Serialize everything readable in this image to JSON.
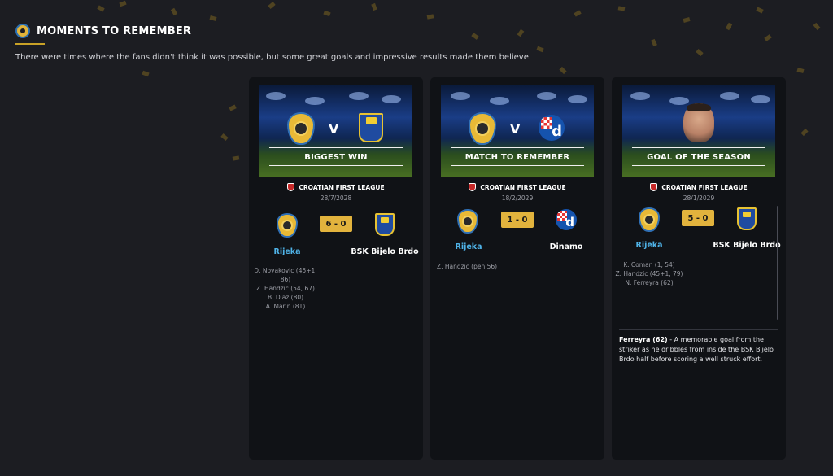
{
  "header": {
    "title": "MOMENTS TO REMEMBER",
    "subtitle": "There were times where the fans didn't think it was possible, but some great goals and impressive results made them believe."
  },
  "cards": [
    {
      "banner_label": "BIGGEST WIN",
      "vs_text": "V",
      "league": "CROATIAN FIRST LEAGUE",
      "date": "28/7/2028",
      "score": "6 - 0",
      "home_team": "Rijeka",
      "away_team": "BSK Bijelo Brdo",
      "scorers": [
        "D. Novakovic (45+1,",
        "86)",
        "Z. Handzic (54, 67)",
        "B. Diaz (80)",
        "A. Marin (81)"
      ]
    },
    {
      "banner_label": "MATCH TO REMEMBER",
      "vs_text": "V",
      "league": "CROATIAN FIRST LEAGUE",
      "date": "18/2/2029",
      "score": "1 - 0",
      "home_team": "Rijeka",
      "away_team": "Dinamo",
      "away_crest_letter": "d",
      "scorers": [
        "Z. Handzic (pen 56)"
      ]
    },
    {
      "banner_label": "GOAL OF THE SEASON",
      "league": "CROATIAN FIRST LEAGUE",
      "date": "28/1/2029",
      "score": "5 - 0",
      "home_team": "Rijeka",
      "away_team": "BSK Bijelo Brdo",
      "scorers": [
        "K. Coman (1, 54)",
        "Z. Handzic (45+1, 79)",
        "N. Ferreyra (62)"
      ],
      "goal_scorer": "Ferreyra (62)",
      "goal_description": " - A memorable goal from the striker as he dribbles from inside the BSK Bijelo Brdo half before scoring a well struck effort."
    }
  ],
  "colors": {
    "background": "#1c1d22",
    "card": "#101216",
    "accent_gold": "#e2b33d",
    "home_team_blue": "#4fb3e8"
  },
  "icons": [
    "trophy-medal-icon",
    "rijeka-crest-icon",
    "bsk-bijelo-brdo-crest-icon",
    "dinamo-crest-icon",
    "croatian-league-icon",
    "player-portrait"
  ]
}
